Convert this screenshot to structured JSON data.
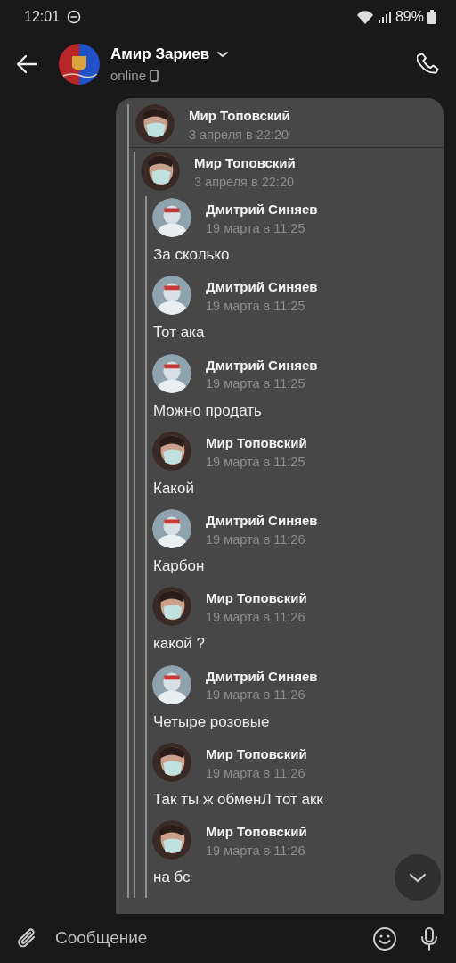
{
  "status_bar": {
    "time": "12:01",
    "battery": "89%"
  },
  "header": {
    "name": "Амир Зариев",
    "status": "online"
  },
  "forward": {
    "author": "Мир Топовский",
    "date": "3 апреля в 22:20",
    "forward": {
      "author": "Мир Топовский",
      "date": "3 апреля в 22:20",
      "messages": [
        {
          "author": "Дмитрий Синяев",
          "date": "19 марта в 11:25",
          "text": "За сколько"
        },
        {
          "author": "Дмитрий Синяев",
          "date": "19 марта в 11:25",
          "text": "Тот ака"
        },
        {
          "author": "Дмитрий Синяев",
          "date": "19 марта в 11:25",
          "text": "Можно продать"
        },
        {
          "author": "Мир Топовский",
          "date": "19 марта в 11:25",
          "text": "Какой"
        },
        {
          "author": "Дмитрий Синяев",
          "date": "19 марта в 11:26",
          "text": "Карбон"
        },
        {
          "author": "Мир Топовский",
          "date": "19 марта в 11:26",
          "text": "какой ?"
        },
        {
          "author": "Дмитрий Синяев",
          "date": "19 марта в 11:26",
          "text": "Четыре розовые"
        },
        {
          "author": "Мир Топовский",
          "date": "19 марта в 11:26",
          "text": "Так ты ж обменЛ тот акк"
        },
        {
          "author": "Мир Топовский",
          "date": "19 марта в 11:26",
          "text": "на бс"
        }
      ]
    }
  },
  "composer": {
    "placeholder": "Сообщение"
  }
}
